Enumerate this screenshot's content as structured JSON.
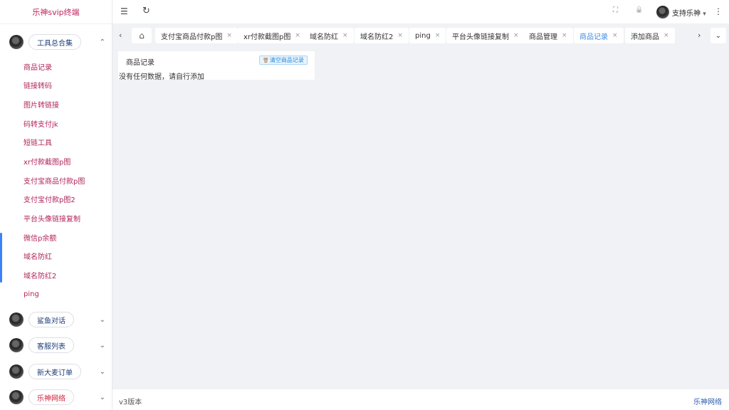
{
  "sidebar": {
    "logo": "乐神svip终端",
    "groups": [
      {
        "label": "工具总合集",
        "chevron": "⌃",
        "expanded": true
      },
      {
        "label": "鲨鱼对话",
        "chevron": "⌄"
      },
      {
        "label": "客服列表",
        "chevron": "⌄"
      },
      {
        "label": "新大麦订单",
        "chevron": "⌄"
      },
      {
        "label": "乐神网络",
        "chevron": "⌄"
      }
    ],
    "items": [
      "商品记录",
      "链接转码",
      "图片转链接",
      "码转支付jk",
      "短链工具",
      "xr付款截图p图",
      "支付宝商品付款p图",
      "支付宝付款p图2",
      "平台头像链接复制",
      "微信p余额",
      "域名防红",
      "域名防红2",
      "ping"
    ]
  },
  "header": {
    "menu_icon": "☰",
    "refresh_icon": "↻",
    "fullscreen_icon": "⛶",
    "lock_icon": "🔒",
    "username": "支持乐神",
    "caret": "▾",
    "more_icon": "⋮"
  },
  "tabs": {
    "prev_icon": "‹",
    "next_icon": "›",
    "home_icon": "⌂",
    "dropdown_icon": "⌄",
    "close_icon": "×",
    "items": [
      {
        "label": "支付宝商品付款p图"
      },
      {
        "label": "xr付款截图p图"
      },
      {
        "label": "域名防红"
      },
      {
        "label": "域名防红2"
      },
      {
        "label": "ping"
      },
      {
        "label": "平台头像链接复制"
      },
      {
        "label": "商品管理"
      },
      {
        "label": "商品记录",
        "active": true
      },
      {
        "label": "添加商品"
      }
    ],
    "active_color": "#3a8ee6"
  },
  "content": {
    "card_title": "商品记录",
    "clear_button": "清空商品记录",
    "clear_icon": "🗑",
    "empty_text": "没有任何数据，请自行添加"
  },
  "footer": {
    "version": "v3版本",
    "brand": "乐神网络"
  }
}
